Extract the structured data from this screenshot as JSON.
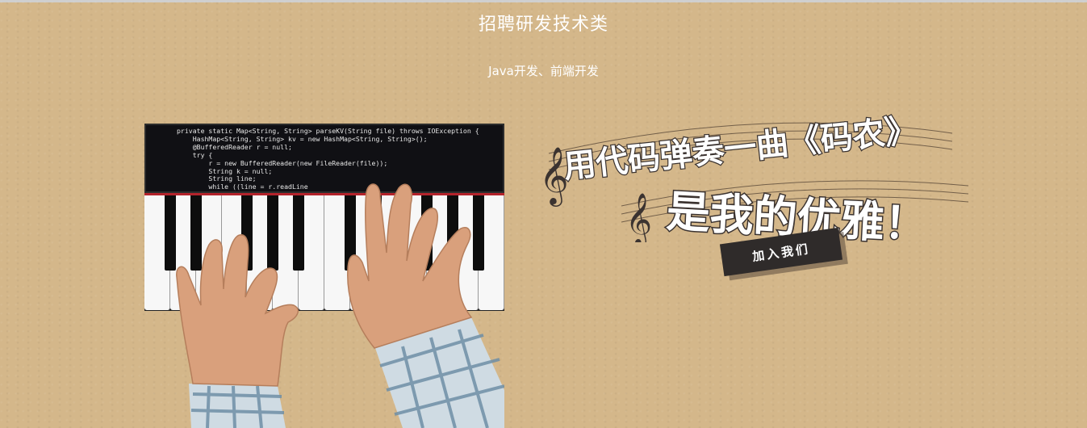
{
  "page": {
    "title": "招聘研发技术类",
    "subtitle": "Java开发、前端开发"
  },
  "code_panel": {
    "lines": [
      "private static Map<String, String> parseKV(String file) throws IOException {",
      "    HashMap<String, String> kv = new HashMap<String, String>();",
      "    @BufferedReader r = null;",
      "    try {",
      "        r = new BufferedReader(new FileReader(file));",
      "        String k = null;",
      "        String line;",
      "        while ((line = r.readLine"
    ]
  },
  "slogan": {
    "line1": "用代码弹奏一曲《码农》",
    "line2": "是我的优雅！"
  },
  "join_button": {
    "label": "加入我们"
  },
  "colors": {
    "background": "#d4b78a",
    "button_bg": "#2f2b2a",
    "piano_strip": "#b3232b"
  }
}
